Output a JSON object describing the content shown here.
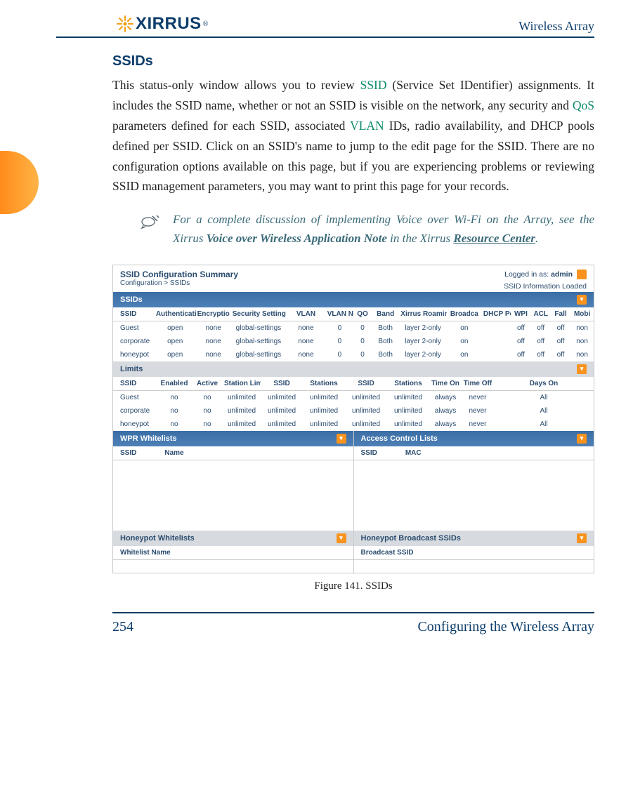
{
  "header": {
    "logo_text": "XIRRUS",
    "doc_title": "Wireless Array"
  },
  "section_heading": "SSIDs",
  "body_paragraph": {
    "t1": "This status-only window allows you to review ",
    "link1": "SSID",
    "t2": " (Service Set IDentifier) assignments. It includes the SSID name, whether or not an SSID is visible on the network, any security and ",
    "link2": "QoS",
    "t3": " parameters defined for each SSID, associated ",
    "link3": "VLAN",
    "t4": " IDs, radio availability, and DHCP pools defined per SSID. Click on an SSID's name to jump to the edit page for the SSID. There are no configuration options available on this page, but if you are experiencing problems or reviewing SSID management parameters, you may want to print this page for your records."
  },
  "note": {
    "t1": "For a complete discussion of implementing Voice over Wi-Fi on the Array, see the Xirrus ",
    "bold1": "Voice over Wireless Application Note",
    "t2": " in the Xirrus ",
    "link": "Resource Center",
    "t3": "."
  },
  "shot": {
    "title": "SSID Configuration Summary",
    "breadcrumb": "Configuration > SSIDs",
    "logged_label": "Logged in as: ",
    "logged_user": "admin",
    "info_loaded": "SSID Information Loaded",
    "band_ssids": "SSIDs",
    "table1_headers": [
      "SSID",
      "Authenticati",
      "Encryptio",
      "Security Settings",
      "VLAN",
      "VLAN Num",
      "QO",
      "Band",
      "Xirrus Roaming",
      "Broadca",
      "DHCP Pool",
      "WPI",
      "ACL",
      "Fall",
      "Mobi"
    ],
    "table1_rows": [
      {
        "ssid": "Guest",
        "auth": "open",
        "enc": "none",
        "sec": "global-settings",
        "vlan": "none",
        "vnum": "0",
        "qos": "0",
        "band": "Both",
        "roam": "layer 2-only",
        "bcast": "on",
        "dhcp": "",
        "wpr": "off",
        "acl": "off",
        "fall": "off",
        "mobi": "non"
      },
      {
        "ssid": "corporate",
        "auth": "open",
        "enc": "none",
        "sec": "global-settings",
        "vlan": "none",
        "vnum": "0",
        "qos": "0",
        "band": "Both",
        "roam": "layer 2-only",
        "bcast": "on",
        "dhcp": "",
        "wpr": "off",
        "acl": "off",
        "fall": "off",
        "mobi": "non"
      },
      {
        "ssid": "honeypot",
        "auth": "open",
        "enc": "none",
        "sec": "global-settings",
        "vlan": "none",
        "vnum": "0",
        "qos": "0",
        "band": "Both",
        "roam": "layer 2-only",
        "bcast": "on",
        "dhcp": "",
        "wpr": "off",
        "acl": "off",
        "fall": "off",
        "mobi": "non"
      }
    ],
    "band_limits": "Limits",
    "table2_headers": [
      "SSID",
      "Enabled",
      "Active",
      "Station Limit",
      "SSID",
      "Stations",
      "SSID",
      "Stations",
      "Time On",
      "Time Off",
      "Days On"
    ],
    "table2_rows": [
      {
        "ssid": "Guest",
        "en": "no",
        "act": "no",
        "slim": "unlimited",
        "c1": "unlimited",
        "c2": "unlimited",
        "c3": "unlimited",
        "c4": "unlimited",
        "ton": "always",
        "toff": "never",
        "days": "All"
      },
      {
        "ssid": "corporate",
        "en": "no",
        "act": "no",
        "slim": "unlimited",
        "c1": "unlimited",
        "c2": "unlimited",
        "c3": "unlimited",
        "c4": "unlimited",
        "ton": "always",
        "toff": "never",
        "days": "All"
      },
      {
        "ssid": "honeypot",
        "en": "no",
        "act": "no",
        "slim": "unlimited",
        "c1": "unlimited",
        "c2": "unlimited",
        "c3": "unlimited",
        "c4": "unlimited",
        "ton": "always",
        "toff": "never",
        "days": "All"
      }
    ],
    "band_wpr": "WPR Whitelists",
    "band_acl": "Access Control Lists",
    "wpr_cols": [
      "SSID",
      "Name"
    ],
    "acl_cols": [
      "SSID",
      "MAC"
    ],
    "band_hwl": "Honeypot Whitelists",
    "band_hbs": "Honeypot Broadcast SSIDs",
    "hwl_col": "Whitelist Name",
    "hbs_col": "Broadcast SSID"
  },
  "figure_caption": "Figure 141. SSIDs",
  "footer": {
    "page_number": "254",
    "section_title": "Configuring the Wireless Array"
  }
}
